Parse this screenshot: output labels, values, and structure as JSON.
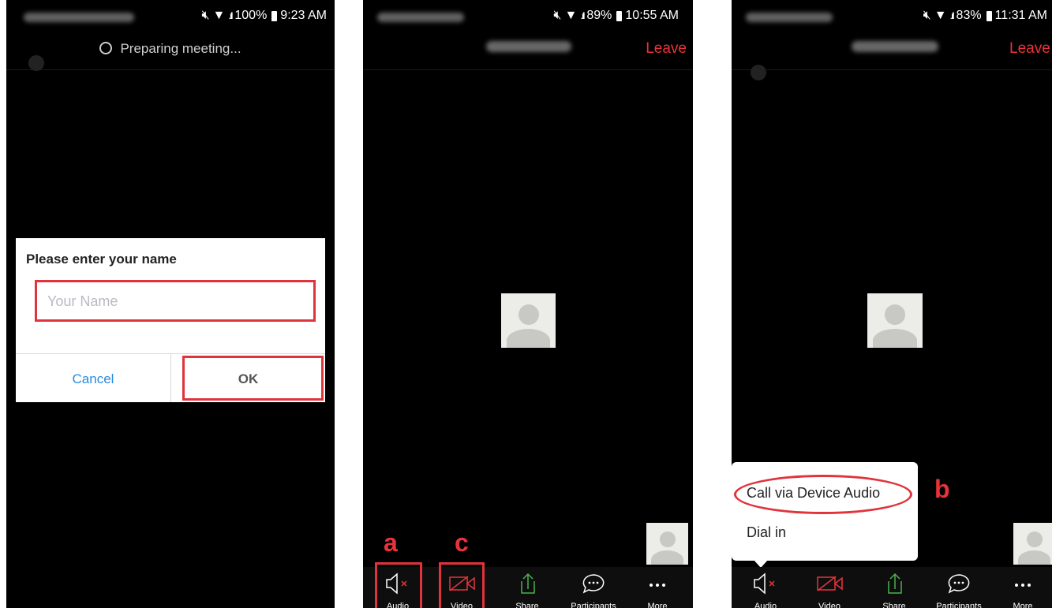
{
  "panel1": {
    "status": {
      "battery": "100%",
      "time": "9:23 AM"
    },
    "preparing_text": "Preparing meeting...",
    "dialog": {
      "title": "Please enter your name",
      "input_placeholder": "Your Name",
      "cancel_label": "Cancel",
      "ok_label": "OK"
    }
  },
  "panel2": {
    "status": {
      "battery": "89%",
      "time": "10:55 AM"
    },
    "leave_label": "Leave",
    "annotation_a": "a",
    "annotation_c": "c",
    "toolbar": {
      "audio_label": "Audio",
      "video_label": "Video",
      "share_label": "Share",
      "participants_label": "Participants",
      "more_label": "More"
    }
  },
  "panel3": {
    "status": {
      "battery": "83%",
      "time": "11:31 AM"
    },
    "leave_label": "Leave",
    "annotation_b": "b",
    "popup": {
      "call_device_audio_label": "Call via Device Audio",
      "dial_in_label": "Dial in"
    },
    "toolbar": {
      "audio_label": "Audio",
      "video_label": "Video",
      "share_label": "Share",
      "participants_label": "Participants",
      "more_label": "More"
    }
  },
  "colors": {
    "accent_red": "#e8333b",
    "link_blue": "#2a8ae0",
    "share_green": "#4cb050"
  },
  "icons": [
    "muted-speaker-icon",
    "video-off-icon",
    "share-icon",
    "chat-bubble-icon",
    "more-dots-icon",
    "avatar-icon",
    "mute-icon",
    "wifi-icon",
    "signal-icon",
    "battery-icon"
  ]
}
